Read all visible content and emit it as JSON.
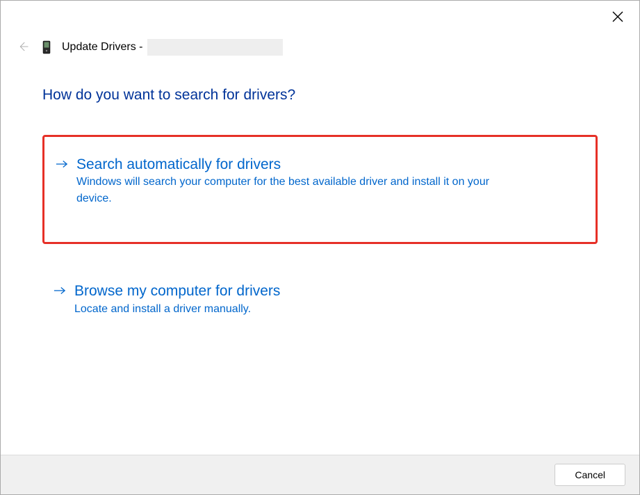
{
  "header": {
    "title_prefix": "Update Drivers - "
  },
  "main": {
    "heading": "How do you want to search for drivers?",
    "options": [
      {
        "title": "Search automatically for drivers",
        "description": "Windows will search your computer for the best available driver and install it on your device."
      },
      {
        "title": "Browse my computer for drivers",
        "description": "Locate and install a driver manually."
      }
    ]
  },
  "footer": {
    "cancel_label": "Cancel"
  },
  "colors": {
    "heading": "#003399",
    "link": "#0066cc",
    "highlight_border": "#e63027"
  }
}
